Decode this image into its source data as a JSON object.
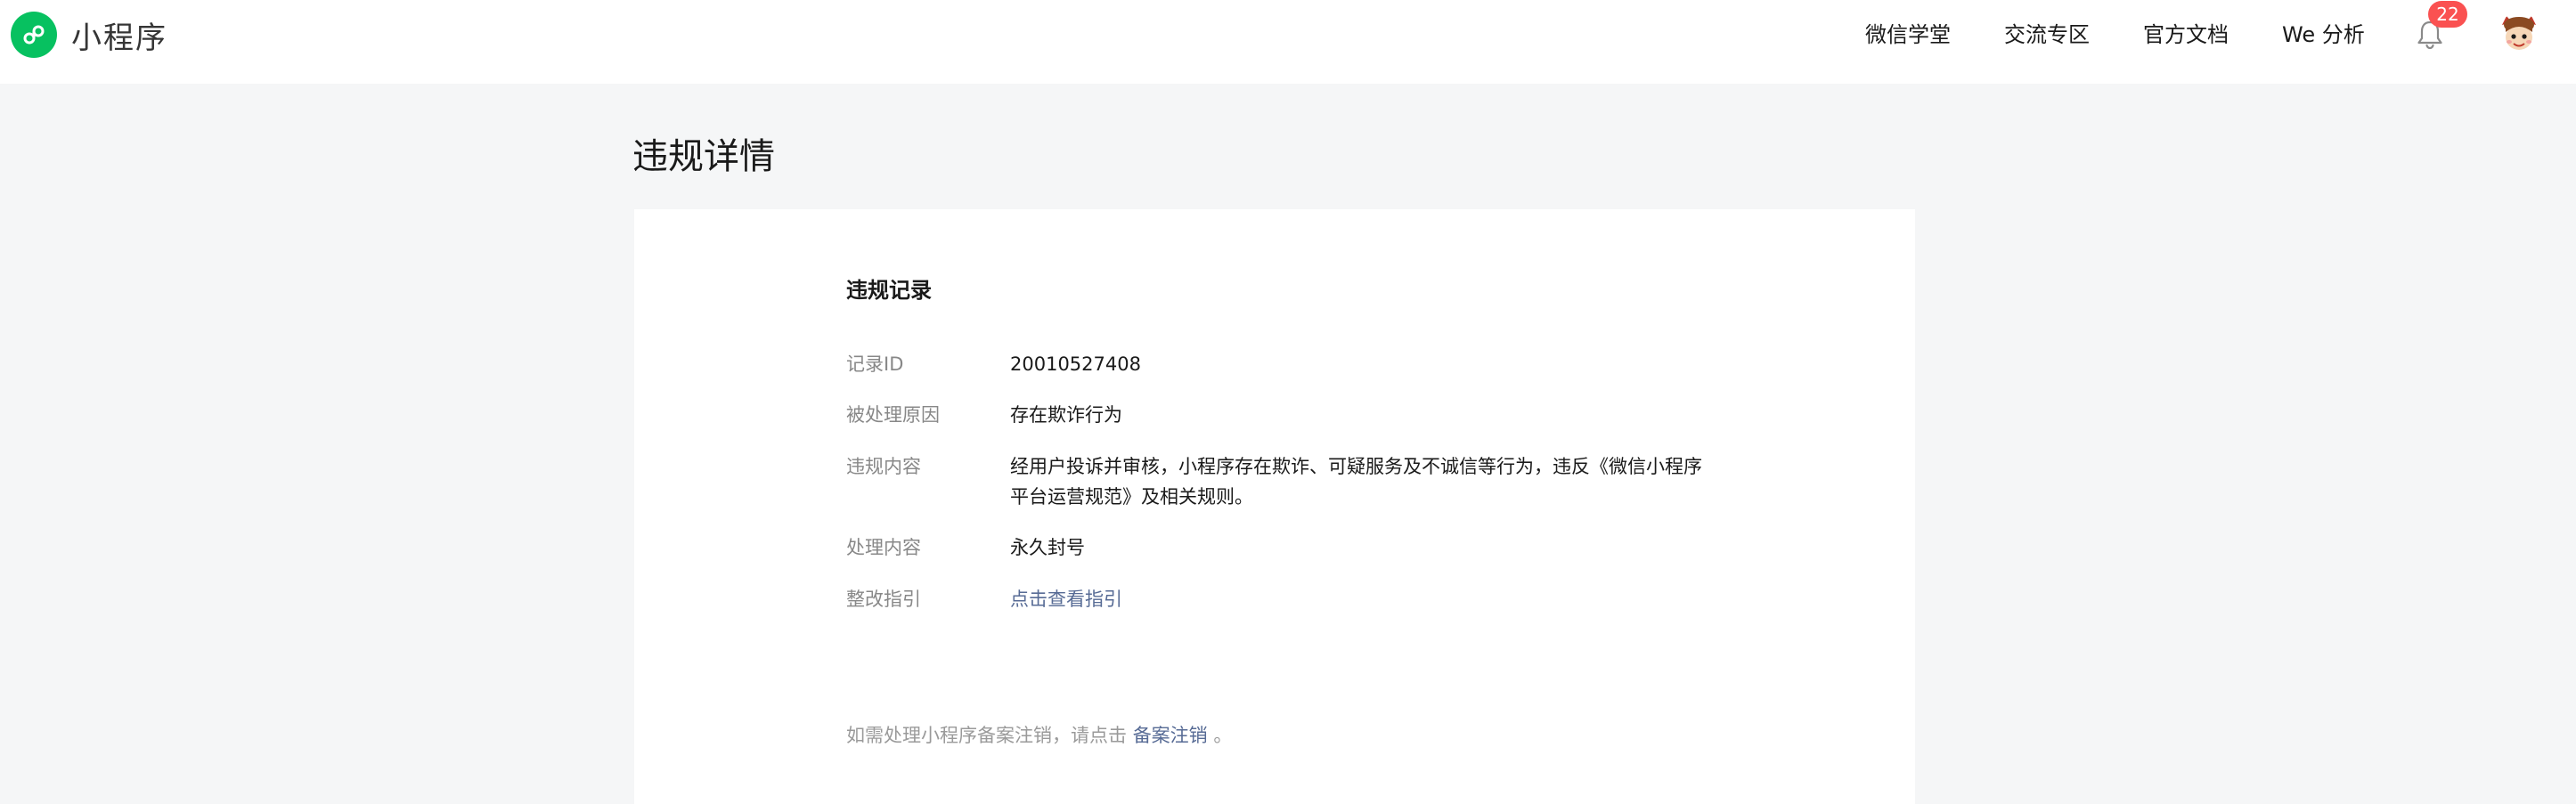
{
  "header": {
    "logo_text": "小程序",
    "nav": [
      {
        "label": "微信学堂"
      },
      {
        "label": "交流专区"
      },
      {
        "label": "官方文档"
      },
      {
        "label": "We 分析"
      }
    ],
    "notification_count": "22"
  },
  "page": {
    "title": "违规详情"
  },
  "record": {
    "section_title": "违规记录",
    "rows": [
      {
        "label": "记录ID",
        "value": "20010527408"
      },
      {
        "label": "被处理原因",
        "value": "存在欺诈行为"
      },
      {
        "label": "违规内容",
        "value": "经用户投诉并审核，小程序存在欺诈、可疑服务及不诚信等行为，违反《微信小程序平台运营规范》及相关规则。"
      },
      {
        "label": "处理内容",
        "value": "永久封号"
      },
      {
        "label": "整改指引",
        "value": "点击查看指引"
      }
    ]
  },
  "footer": {
    "prefix": "如需处理小程序备案注销，请点击",
    "link": "备案注销",
    "suffix": "。"
  },
  "colors": {
    "brand_green": "#07c160",
    "link_blue": "#576b95",
    "badge_red": "#fa5151",
    "page_bg": "#f5f6f7"
  },
  "icons": {
    "logo": "mini-program-logo-icon",
    "bell": "bell-icon",
    "avatar": "user-avatar"
  }
}
